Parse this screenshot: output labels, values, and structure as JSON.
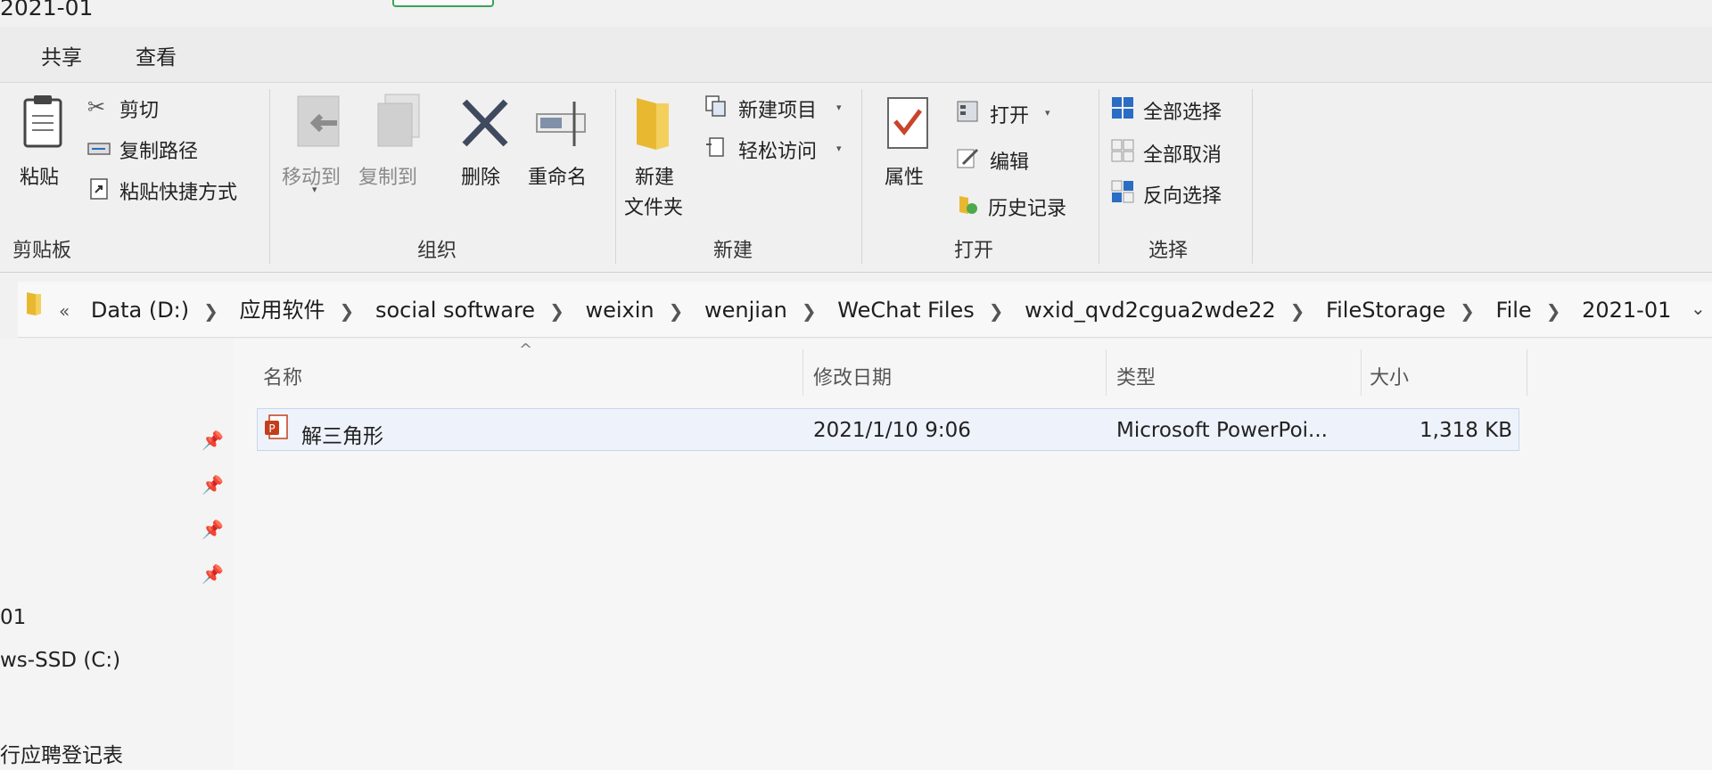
{
  "window": {
    "title": "2021-01"
  },
  "menu": {
    "share": "共享",
    "view": "查看"
  },
  "ribbon": {
    "clipboard": {
      "group_label": "剪贴板",
      "paste": "粘贴",
      "cut": "剪切",
      "copy_path": "复制路径",
      "paste_shortcut": "粘贴快捷方式"
    },
    "organize": {
      "group_label": "组织",
      "move_to": "移动到",
      "copy_to": "复制到",
      "delete": "删除",
      "rename": "重命名"
    },
    "new": {
      "group_label": "新建",
      "new_folder_line1": "新建",
      "new_folder_line2": "文件夹",
      "new_item": "新建项目",
      "easy_access": "轻松访问"
    },
    "open": {
      "group_label": "打开",
      "properties": "属性",
      "open": "打开",
      "edit": "编辑",
      "history": "历史记录"
    },
    "select": {
      "group_label": "选择",
      "select_all": "全部选择",
      "select_none": "全部取消",
      "invert_selection": "反向选择"
    }
  },
  "address": {
    "overflow": "«",
    "crumbs": [
      "Data (D:)",
      "应用软件",
      "social software",
      "weixin",
      "wenjian",
      "WeChat Files",
      "wxid_qvd2cgua2wde22",
      "FileStorage",
      "File",
      "2021-01"
    ]
  },
  "sidebar": {
    "item_01": "01",
    "item_ssd": "ws-SSD (C:)",
    "item_form": "行应聘登记表"
  },
  "columns": {
    "name": "名称",
    "date": "修改日期",
    "type": "类型",
    "size": "大小"
  },
  "files": [
    {
      "name": "解三角形",
      "date": "2021/1/10 9:06",
      "type": "Microsoft PowerPoi...",
      "size": "1,318 KB"
    }
  ],
  "colors": {
    "accent_blue": "#2b6cc4",
    "selection": "#eef3fb",
    "ppt_red": "#c43e1c",
    "folder_yellow": "#e8b830"
  }
}
